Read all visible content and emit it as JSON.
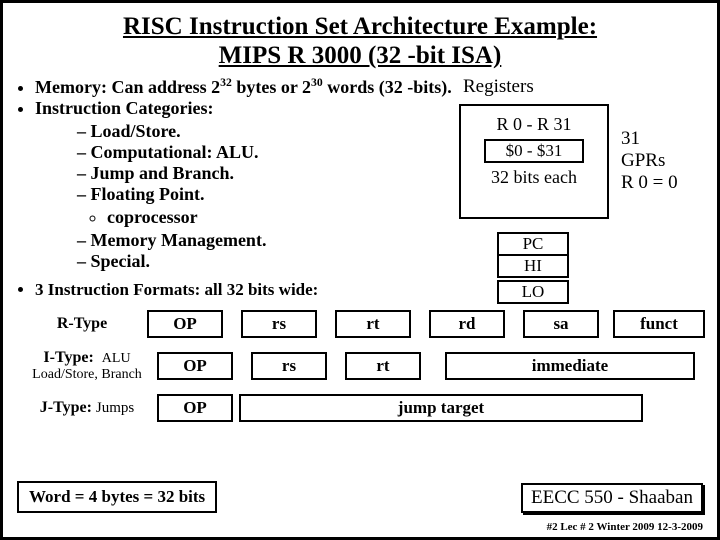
{
  "title": "RISC Instruction Set Architecture Example:",
  "subtitle": "MIPS R 3000  (32 -bit ISA)",
  "bullets": {
    "memory_a": "Memory:  Can address 2",
    "memory_exp1": "32",
    "memory_b": " bytes or 2",
    "memory_exp2": "30",
    "memory_c": " words (32 -bits).",
    "instr_cat": "Instruction Categories:",
    "sub": {
      "loadstore": "Load/Store.",
      "alu": "Computational: ALU.",
      "jump": "Jump and Branch.",
      "fp": "Floating Point.",
      "coproc": "coprocessor",
      "mm": "Memory Management.",
      "special": "Special."
    }
  },
  "registers": {
    "label": "Registers",
    "range": "R 0 - R 31",
    "dollar": "$0  - $31",
    "each": "32 bits each",
    "gpr1": "31",
    "gpr2": "GPRs",
    "gpr3": "R 0 = 0",
    "pc": "PC",
    "hi": "HI",
    "lo": "LO"
  },
  "formats_head": "3 Instruction Formats: all 32 bits wide:",
  "fmt": {
    "r": {
      "name": "R-Type",
      "op": "OP",
      "rs": "rs",
      "rt": "rt",
      "rd": "rd",
      "sa": "sa",
      "funct": "funct"
    },
    "i": {
      "name1": "I-Type:",
      "name2": "ALU",
      "name3": "Load/Store, Branch",
      "op": "OP",
      "rs": "rs",
      "rt": "rt",
      "imm": "immediate"
    },
    "j": {
      "name1": "J-Type:",
      "name2": "Jumps",
      "op": "OP",
      "jt": "jump target"
    }
  },
  "word": "Word = 4 bytes = 32 bits",
  "course": "EECC 550 - Shaaban",
  "tiny": "#2  Lec # 2  Winter 2009  12-3-2009"
}
